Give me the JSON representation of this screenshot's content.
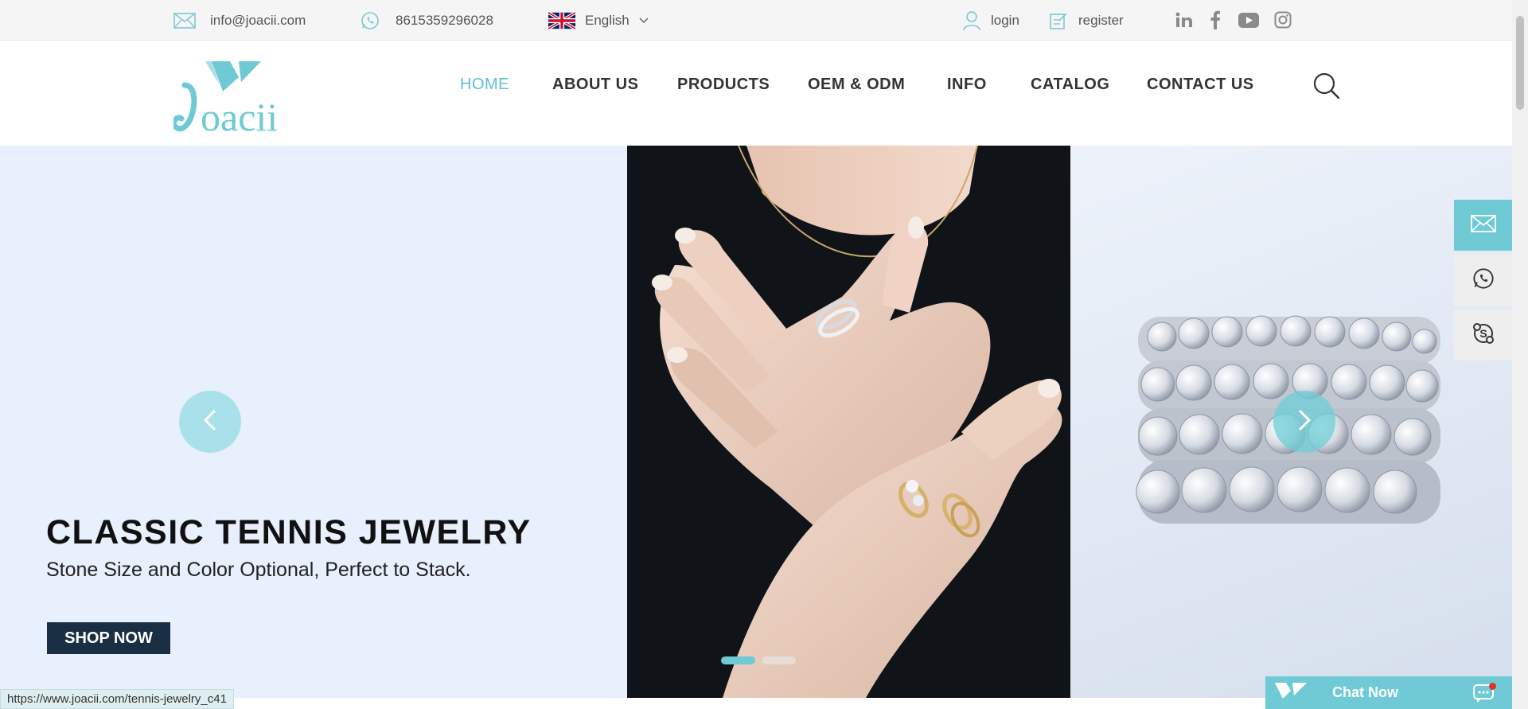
{
  "topbar": {
    "email": "info@joacii.com",
    "phone": "8615359296028",
    "language": "English",
    "login": "login",
    "register": "register",
    "social": [
      "linkedin-icon",
      "facebook-icon",
      "youtube-icon",
      "instagram-icon"
    ]
  },
  "header": {
    "logo_text": "Joacii",
    "nav": [
      {
        "label": "HOME",
        "active": true
      },
      {
        "label": "ABOUT US",
        "active": false
      },
      {
        "label": "PRODUCTS",
        "active": false
      },
      {
        "label": "OEM & ODM",
        "active": false
      },
      {
        "label": "INFO",
        "active": false
      },
      {
        "label": "CATALOG",
        "active": false
      },
      {
        "label": "CONTACT US",
        "active": false
      }
    ]
  },
  "hero": {
    "title": "CLASSIC TENNIS JEWELRY",
    "subtitle": "Stone Size and Color Optional, Perfect to Stack.",
    "cta": "SHOP NOW",
    "slides": 2,
    "active_slide": 1
  },
  "side_float": [
    "email-icon",
    "whatsapp-icon",
    "skype-icon"
  ],
  "chat": {
    "label": "Chat Now"
  },
  "status_url": "https://www.joacii.com/tennis-jewelry_c41",
  "colors": {
    "accent": "#5dbfd3",
    "hero_bg": "#e8effd",
    "cta_bg": "#1b2f44"
  }
}
